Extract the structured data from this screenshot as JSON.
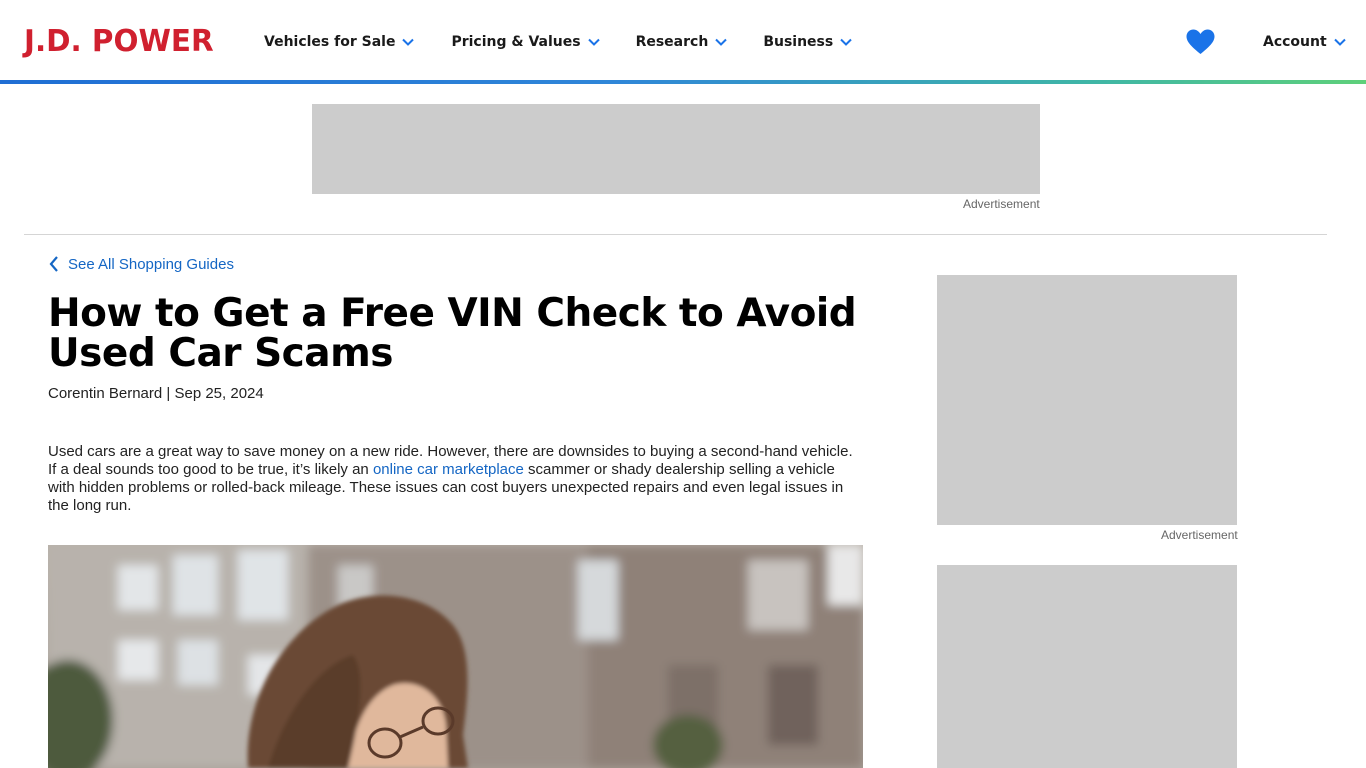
{
  "header": {
    "logo": "J.D. POWER",
    "nav": [
      {
        "label": "Vehicles for Sale"
      },
      {
        "label": "Pricing & Values"
      },
      {
        "label": "Research"
      },
      {
        "label": "Business"
      }
    ],
    "account_label": "Account",
    "favorites_icon": "heart-icon"
  },
  "ads": {
    "top_label": "Advertisement",
    "side1_label": "Advertisement"
  },
  "article": {
    "back_link": "See All Shopping Guides",
    "title": "How to Get a Free VIN Check to Avoid Used Car Scams",
    "author": "Corentin Bernard",
    "separator": " | ",
    "date": "Sep 25, 2024",
    "intro_before_link": "Used cars are a great way to save money on a new ride. However, there are downsides to buying a second-hand vehicle. If a deal sounds too good to be true, it’s likely an ",
    "intro_link": "online car marketplace",
    "intro_after_link": " scammer or shady dealership selling a vehicle with hidden problems or rolled-back mileage. These issues can cost buyers unexpected repairs and even legal issues in the long run."
  },
  "colors": {
    "brand_red": "#d0202f",
    "link_blue": "#1466c4",
    "heart_blue": "#1a73e8",
    "ad_gray": "#cccccc"
  }
}
